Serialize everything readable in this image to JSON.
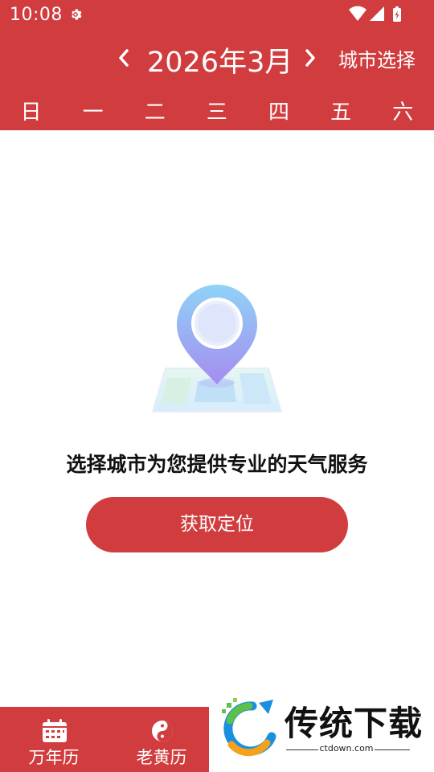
{
  "status_bar": {
    "time": "10:08"
  },
  "header": {
    "month_title": "2026年3月",
    "city_select_label": "城市选择",
    "weekdays": [
      "日",
      "一",
      "二",
      "三",
      "四",
      "五",
      "六"
    ],
    "accent_color": "#d13c3e"
  },
  "main": {
    "empty_message": "选择城市为您提供专业的天气服务",
    "locate_button_label": "获取定位",
    "illustration_icon": "location-pin-map-icon"
  },
  "bottom_nav": {
    "tabs": [
      {
        "label": "万年历",
        "icon": "calendar-icon"
      },
      {
        "label": "老黄历",
        "icon": "yin-yang-icon"
      }
    ]
  },
  "watermark": {
    "brand": "传统下载",
    "domain": "ctdown.com"
  }
}
